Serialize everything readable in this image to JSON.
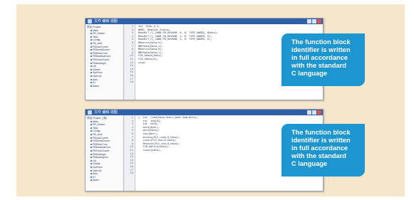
{
  "windows": [
    {
      "title": "文件 编辑 视图",
      "tree": [
        {
          "label": "项目 Project",
          "level": 0
        },
        {
          "label": "Main",
          "level": 1
        },
        {
          "label": "FB_Motion",
          "level": 1
        },
        {
          "label": "Task",
          "level": 1
        },
        {
          "label": "Config",
          "level": 1
        },
        {
          "label": "FB_Axis",
          "level": 1
        },
        {
          "label": "FBCanComm",
          "level": 1
        },
        {
          "label": "FBSerialComm",
          "level": 1
        },
        {
          "label": "FBEtherCom",
          "level": 1
        },
        {
          "label": "FBModbusCom",
          "level": 1
        },
        {
          "label": "FBTimerCount",
          "level": 1
        },
        {
          "label": "FBAnalogIn",
          "level": 1
        },
        {
          "label": "Lib",
          "level": 1
        },
        {
          "label": "Global",
          "level": 1
        },
        {
          "label": "SysFunc",
          "level": 1
        },
        {
          "label": "UserLib",
          "level": 1
        },
        {
          "label": "Axis",
          "level": 1
        },
        {
          "label": "IO",
          "level": 1
        },
        {
          "label": "Alarm",
          "level": 1
        }
      ],
      "line_numbers": [
        "1",
        "2",
        "3",
        "4",
        "5",
        "6",
        "7",
        "8",
        "9",
        "10",
        "11",
        "12",
        "13",
        "14",
        "15",
        "16",
        "17",
        "18"
      ],
      "code": [
        "int  bCan_3_1;",
        "WORD  ReadCnt_Status;",
        "",
        "ReadEtT_C(_CANB_FB_DEVNUM, 0, 0, TYPE_DWORD, &Data);",
        "ReadEtT_C(_CANB_FB_DEVNUM, 1, 0, TYPE_DWORD, 0);",
        "ReadEtT_C(_CANB_FB_DEVNUM, 2, 0, TYPE_DWORD, 0);",
        "",
        "MbWrite(Data,0);",
        "MBFData(Data,1);",
        "",
        "MbWrite(Data,0);",
        "MBFData(Data,1);",
        "",
        "FCB_bData(Data);",
        "FCB_bData(0);",
        "",
        "Loop;",
        ""
      ]
    },
    {
      "title": "文件 编辑 视图",
      "tree": [
        {
          "label": "项目 Project 工程",
          "level": 0
        },
        {
          "label": "Main",
          "level": 1
        },
        {
          "label": "FB_Motion",
          "level": 1
        },
        {
          "label": "Task",
          "level": 1
        },
        {
          "label": "Config",
          "level": 1
        },
        {
          "label": "FB_Axis",
          "level": 1
        },
        {
          "label": "FBCanComm",
          "level": 1
        },
        {
          "label": "FBSerialComm",
          "level": 1
        },
        {
          "label": "FBEtherCom",
          "level": 1
        },
        {
          "label": "FBModbusCom",
          "level": 1
        },
        {
          "label": "FBTimerCount",
          "level": 1
        },
        {
          "label": "FBAnalogIn",
          "level": 1
        },
        {
          "label": "FBAnalogOut",
          "level": 1
        },
        {
          "label": "Lib",
          "level": 1
        },
        {
          "label": "Global",
          "level": 1
        },
        {
          "label": "SysFunc",
          "level": 1
        },
        {
          "label": "UserLib",
          "level": 1
        },
        {
          "label": "Axis",
          "level": 1
        },
        {
          "label": "IO",
          "level": 1
        },
        {
          "label": "Alarm",
          "level": 1
        }
      ],
      "line_numbers": [
        "1",
        "2",
        "3",
        "4",
        "5",
        "6",
        "7",
        "8",
        "9",
        "10",
        "11",
        "12",
        "13",
        "14",
        "15",
        "16",
        "17",
        "18"
      ],
      "code": [
        "{  int  read(Data,Start,Addr,Num,Word);",
        "   int  tmp[8];",
        "   int  Data;",
        "   word(Addr);",
        "   word(Data);",
        "   ret(Addr);",
        "",
        "   Access(PLC_read,0,Data);",
        "   Local(PLC_end,0,Data);",
        "   Receive(PLC_end,0,Data);",
        "   FCB_bWrite(Data);",
        "   Local(Data);",
        "",
        "",
        "",
        "",
        "",
        ""
      ]
    }
  ],
  "callouts": [
    {
      "lines": [
        "The function block",
        "identifier is written",
        "in full accordance",
        "with the standard",
        "C language"
      ]
    },
    {
      "lines": [
        "The function block",
        "identifier is written",
        "in full accordance",
        "with the standard",
        "C language"
      ]
    }
  ]
}
